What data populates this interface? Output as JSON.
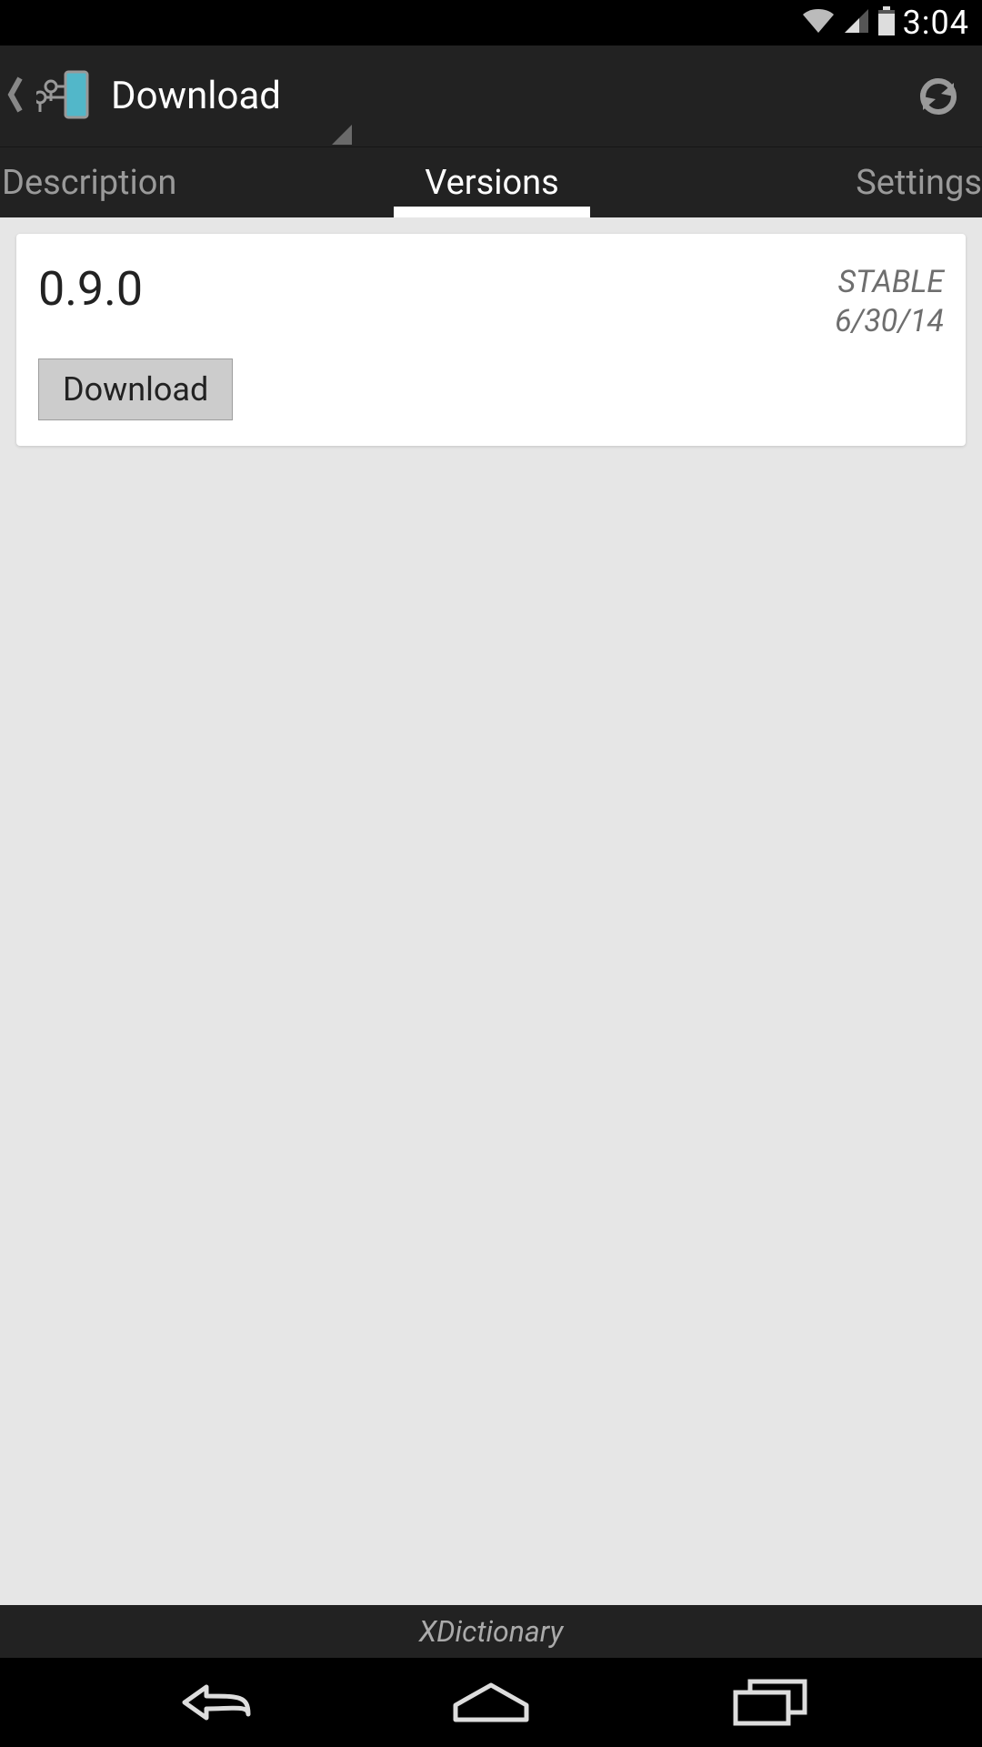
{
  "status": {
    "time": "3:04"
  },
  "header": {
    "title": "Download"
  },
  "tabs": {
    "items": [
      {
        "label": "Description"
      },
      {
        "label": "Versions"
      },
      {
        "label": "Settings"
      }
    ],
    "active_index": 1
  },
  "versions": [
    {
      "number": "0.9.0",
      "channel": "STABLE",
      "date": "6/30/14",
      "button_label": "Download"
    }
  ],
  "footer": {
    "module_name": "XDictionary"
  }
}
